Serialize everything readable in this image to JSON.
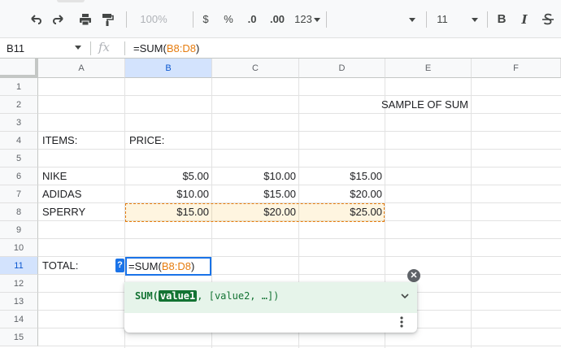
{
  "toolbar": {
    "zoom": "100%",
    "currency": "$",
    "percent": "%",
    "decrease_decimal": ".0",
    "increase_decimal": ".00",
    "more_formats": "123",
    "font_size": "11",
    "bold": "B",
    "italic": "I"
  },
  "formula_bar": {
    "name_box": "B11",
    "fx_label": "fx",
    "formula_prefix": "=SUM(",
    "formula_range": "B8:D8",
    "formula_suffix": ")"
  },
  "columns": [
    "A",
    "B",
    "C",
    "D",
    "E",
    "F"
  ],
  "rows": [
    "1",
    "2",
    "3",
    "4",
    "5",
    "6",
    "7",
    "8",
    "9",
    "10",
    "11",
    "12",
    "13",
    "14",
    "15"
  ],
  "cells": {
    "E2": "SAMPLE OF SUM",
    "A4": "ITEMS:",
    "B4": "PRICE:",
    "A6": "NIKE",
    "B6": "$5.00",
    "C6": "$10.00",
    "D6": "$15.00",
    "A7": "ADIDAS",
    "B7": "$10.00",
    "C7": "$15.00",
    "D7": "$20.00",
    "A8": "SPERRY",
    "B8": "$15.00",
    "C8": "$20.00",
    "D8": "$25.00",
    "A11": "TOTAL:"
  },
  "editor": {
    "help_badge": "?",
    "prefix": "=SUM(",
    "range": "B8:D8",
    "suffix": ")"
  },
  "formula_help": {
    "function_name": "SUM(",
    "current_arg": "value1",
    "rest": ", [value2, …])",
    "close_symbol": "✕"
  },
  "colors": {
    "reference": "#e67c0e",
    "selection": "#1a73e8",
    "help_green": "#137333"
  }
}
